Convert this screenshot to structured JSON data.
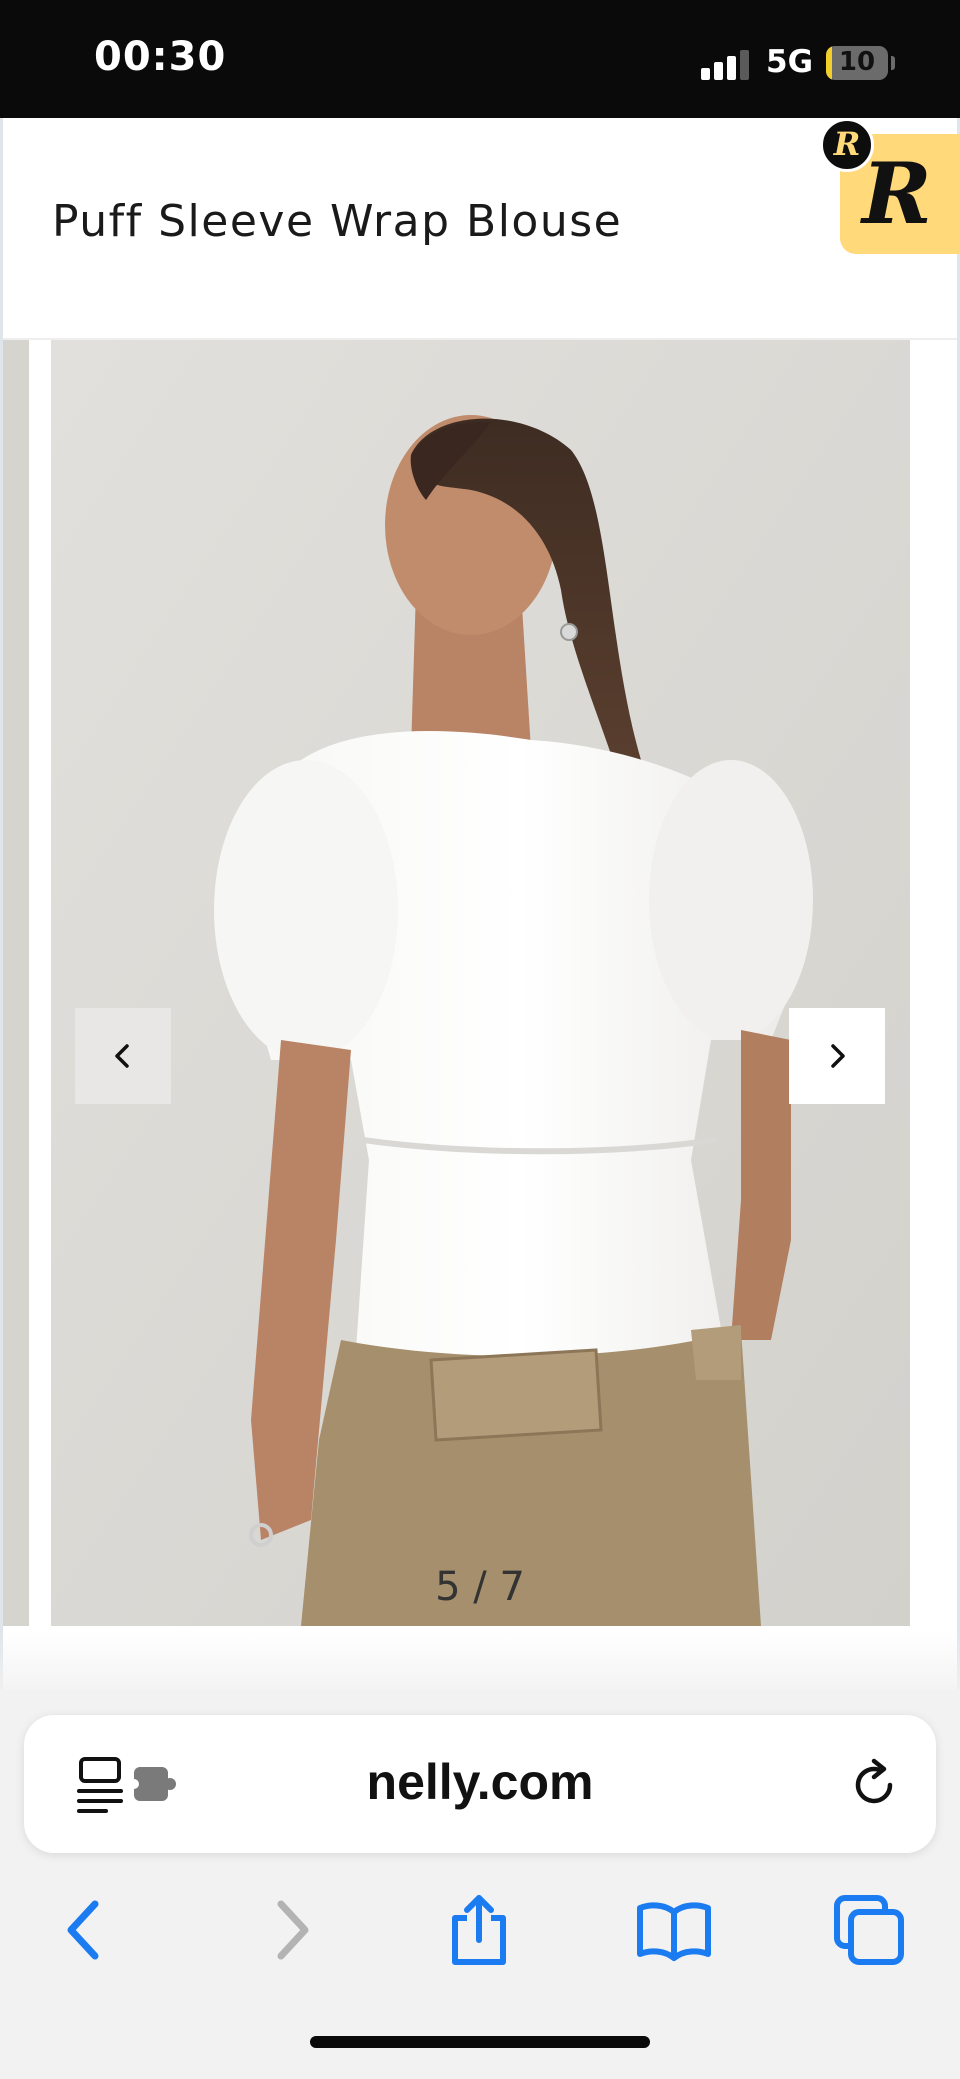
{
  "status_bar": {
    "time": "00:30",
    "network": "5G",
    "battery_level": "10",
    "battery_fraction": 0.1,
    "signal_bars_active": 3,
    "signal_bars_total": 4
  },
  "product": {
    "title": "Puff Sleeve Wrap Blouse"
  },
  "badge": {
    "big_letter": "R",
    "small_letter": "R",
    "color": "#ffd97a"
  },
  "carousel": {
    "image_alt": "Model wearing white puff sleeve wrap blouse, back view",
    "prev_icon": "chevron-left-icon",
    "next_icon": "chevron-right-icon",
    "counter": "5 / 7"
  },
  "browser": {
    "url": "nelly.com",
    "reader_icon": "reader-extension-icon",
    "reload_icon": "reload-icon",
    "toolbar": [
      "back-icon",
      "forward-icon",
      "share-icon",
      "bookmarks-icon",
      "tabs-icon"
    ],
    "accent_color": "#1a7cf0"
  }
}
